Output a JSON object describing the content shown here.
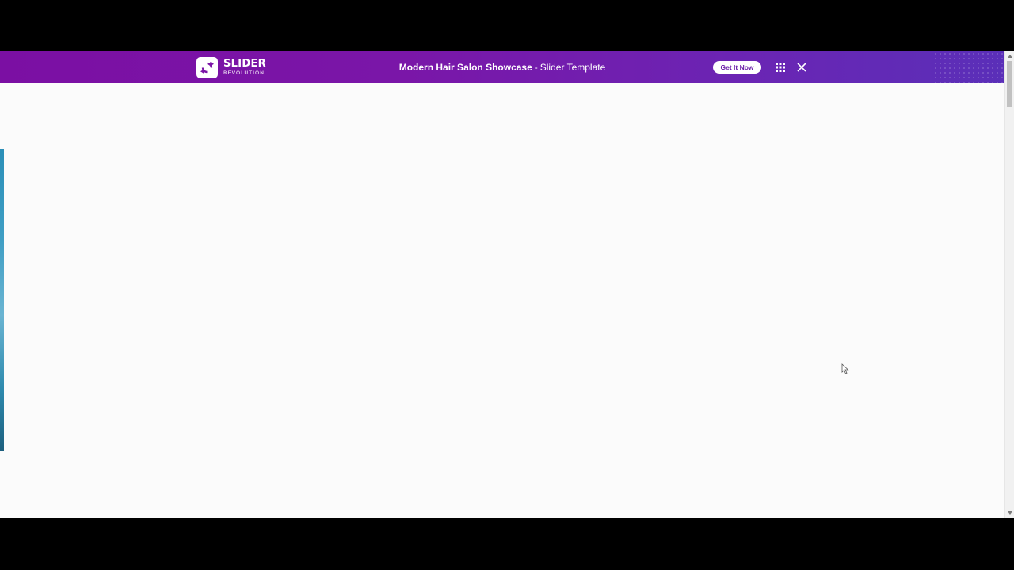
{
  "brand": {
    "name": "SLIDER",
    "sub": "REVOLUTION",
    "logo_icon": "slider-revolution-logo-icon"
  },
  "topbar": {
    "title_strong": "Modern Hair Salon Showcase",
    "title_separator": "-",
    "title_rest": "Slider Template",
    "get_button_label": "Get It Now",
    "grid_icon": "grid-icon",
    "close_icon": "close-icon"
  },
  "colors": {
    "bar_start": "#7b0fa3",
    "bar_end": "#5a2fb8",
    "button_text": "#6a1ea8",
    "page_bg": "#fbfbfb"
  }
}
